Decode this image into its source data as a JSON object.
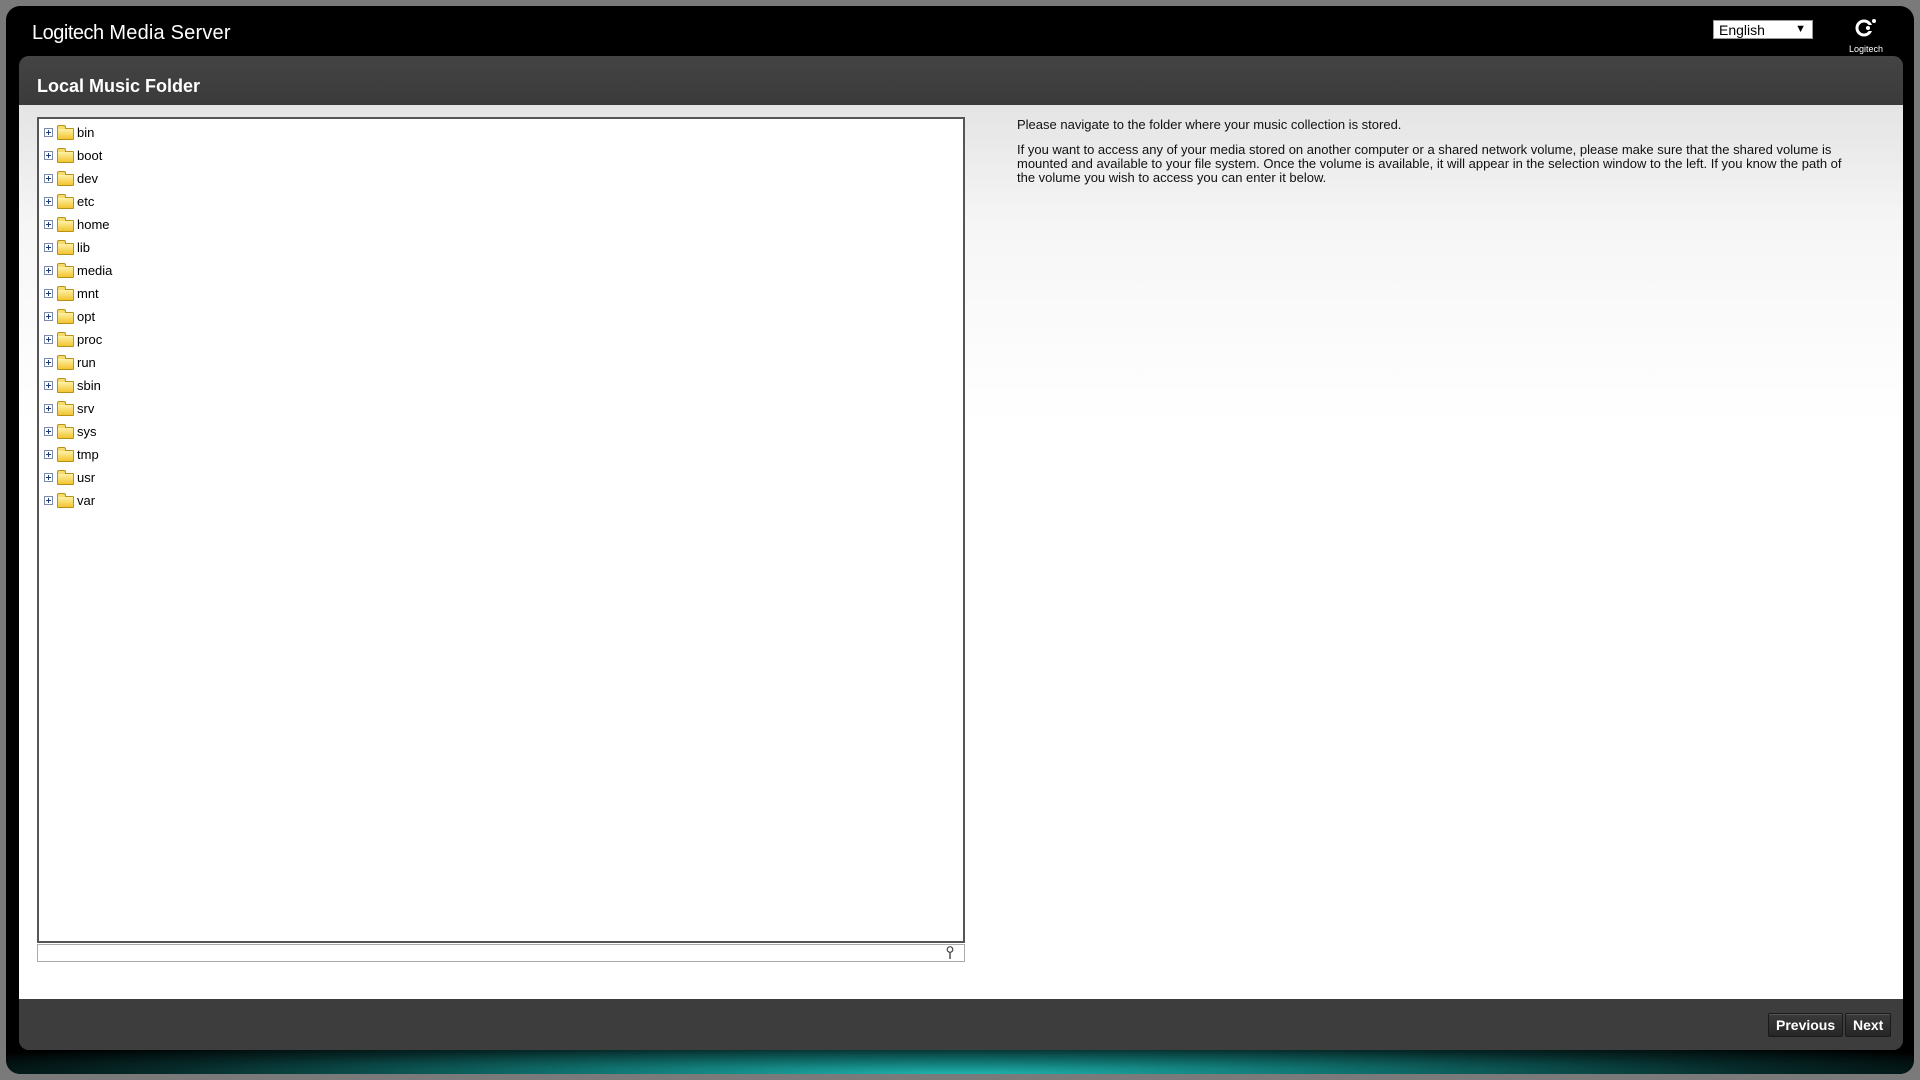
{
  "header": {
    "brand": "Logitech",
    "product": "Media Server",
    "language": {
      "selected": "English"
    },
    "logo_text": "Logitech"
  },
  "page": {
    "title": "Local Music Folder"
  },
  "tree": {
    "folders": [
      "bin",
      "boot",
      "dev",
      "etc",
      "home",
      "lib",
      "media",
      "mnt",
      "opt",
      "proc",
      "run",
      "sbin",
      "srv",
      "sys",
      "tmp",
      "usr",
      "var"
    ]
  },
  "path_input": {
    "value": ""
  },
  "help": {
    "paragraph1": "Please navigate to the folder where your music collection is stored.",
    "paragraph2": "If you want to access any of your media stored on another computer or a shared network volume, please make sure that the shared volume is mounted and available to your file system. Once the volume is available, it will appear in the selection window to the left. If you know the path of the volume you wish to access you can enter it below."
  },
  "footer": {
    "previous_label": "Previous",
    "next_label": "Next"
  },
  "icons": {
    "expander": "plus-box-icon",
    "folder": "folder-icon",
    "pin": "pin-icon"
  }
}
